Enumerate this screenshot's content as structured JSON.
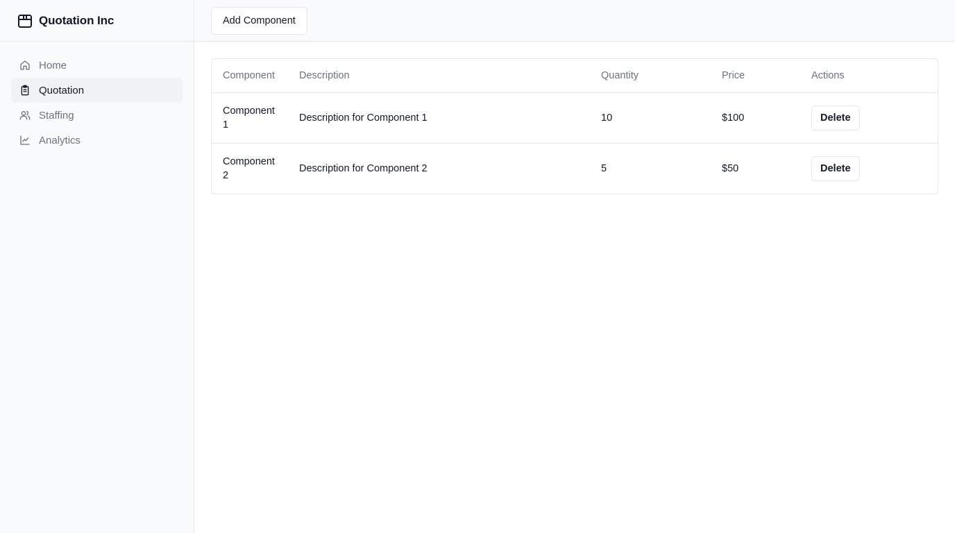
{
  "brand": {
    "name": "Quotation Inc",
    "icon": "package-icon"
  },
  "sidebar": {
    "items": [
      {
        "label": "Home",
        "icon": "home-icon",
        "active": false
      },
      {
        "label": "Quotation",
        "icon": "clipboard-icon",
        "active": true
      },
      {
        "label": "Staffing",
        "icon": "users-icon",
        "active": false
      },
      {
        "label": "Analytics",
        "icon": "chart-line-icon",
        "active": false
      }
    ]
  },
  "toolbar": {
    "add_label": "Add Component"
  },
  "table": {
    "headers": [
      "Component",
      "Description",
      "Quantity",
      "Price",
      "Actions"
    ],
    "rows": [
      {
        "component": "Component 1",
        "description": "Description for Component 1",
        "quantity": "10",
        "price": "$100",
        "action": "Delete"
      },
      {
        "component": "Component 2",
        "description": "Description for Component 2",
        "quantity": "5",
        "price": "$50",
        "action": "Delete"
      }
    ]
  },
  "colors": {
    "sidebar_bg": "#f9fafb",
    "border": "#e5e7eb",
    "active_bg": "#f1f2f4",
    "muted_text": "#6b7280",
    "text": "#111827"
  }
}
